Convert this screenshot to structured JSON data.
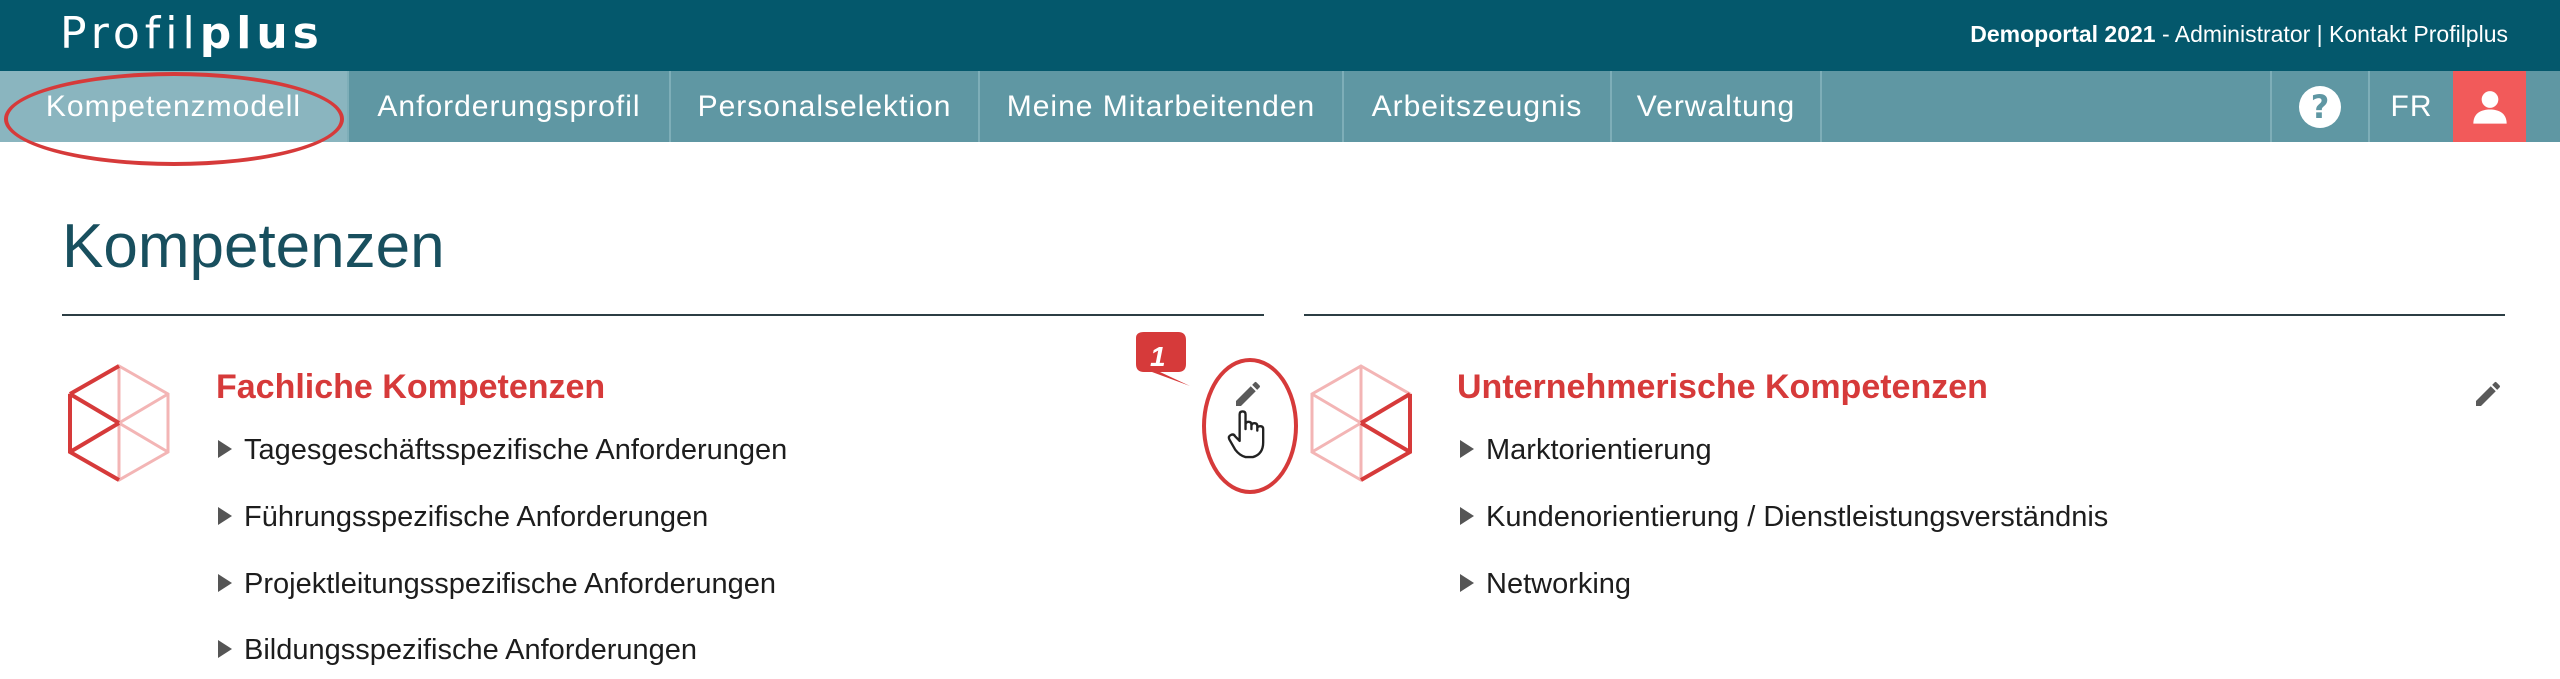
{
  "header": {
    "logo_regular": "Profil",
    "logo_bold": "plus",
    "portal": "Demoportal 2021",
    "info_rest": " - Administrator | Kontakt Profilplus"
  },
  "nav": {
    "items": [
      "Kompetenzmodell",
      "Anforderungsprofil",
      "Personalselektion",
      "Meine Mitarbeitenden",
      "Arbeitszeugnis",
      "Verwaltung"
    ],
    "active": "Kompetenzmodell",
    "help_symbol": "?",
    "language": "FR",
    "icons": [
      "help-icon",
      "user-icon"
    ]
  },
  "page": {
    "title": "Kompetenzen"
  },
  "annotation": {
    "step": "1"
  },
  "cards": [
    {
      "title": "Fachliche Kompetenzen",
      "items": [
        "Tagesgeschäftsspezifische Anforderungen",
        "Führungsspezifische Anforderungen",
        "Projektleitungsspezifische Anforderungen",
        "Bildungsspezifische Anforderungen"
      ]
    },
    {
      "title": "Unternehmerische Kompetenzen",
      "items": [
        "Marktorientierung",
        "Kundenorientierung / Dienstleistungsverständnis",
        "Networking"
      ]
    }
  ],
  "colors": {
    "topbar": "#04586c",
    "navbar": "#5f97a3",
    "nav_active": "#8ab5bf",
    "accent_red": "#d63a3a",
    "user_button": "#f25a5a"
  }
}
